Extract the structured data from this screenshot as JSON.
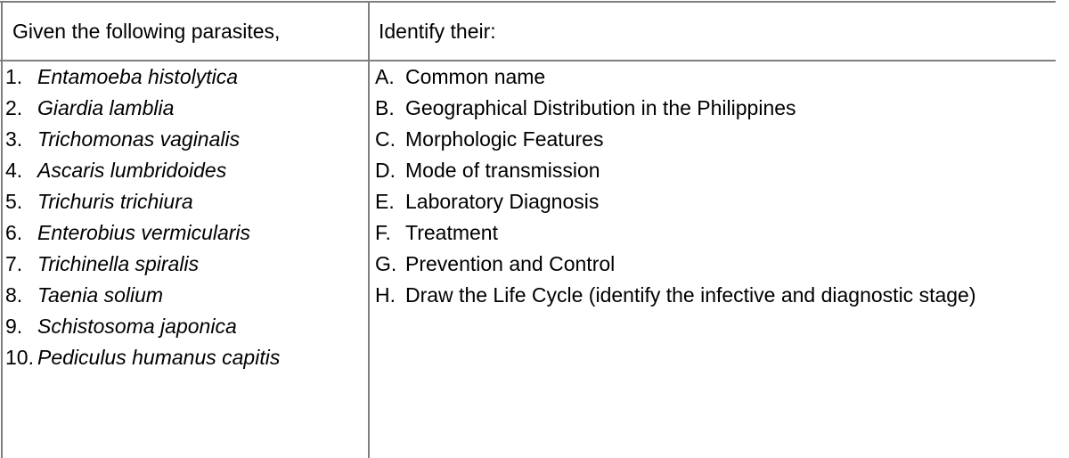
{
  "table": {
    "columns": [
      {
        "header": "Given the following parasites,",
        "list_style": "decimal",
        "items": [
          {
            "marker": "1.",
            "label": "Entamoeba histolytica"
          },
          {
            "marker": "2.",
            "label": "Giardia lamblia"
          },
          {
            "marker": "3.",
            "label": "Trichomonas vaginalis"
          },
          {
            "marker": "4.",
            "label": "Ascaris lumbridoides"
          },
          {
            "marker": "5.",
            "label": "Trichuris trichiura"
          },
          {
            "marker": "6.",
            "label": "Enterobius vermicularis"
          },
          {
            "marker": "7.",
            "label": "Trichinella spiralis"
          },
          {
            "marker": "8.",
            "label": "Taenia solium"
          },
          {
            "marker": "9.",
            "label": "Schistosoma japonica"
          },
          {
            "marker": "10.",
            "label": "Pediculus humanus capitis"
          }
        ]
      },
      {
        "header": "Identify their:",
        "list_style": "upper-alpha",
        "items": [
          {
            "marker": "A.",
            "label": "Common name"
          },
          {
            "marker": "B.",
            "label": "Geographical Distribution in the Philippines"
          },
          {
            "marker": "C.",
            "label": "Morphologic Features"
          },
          {
            "marker": "D.",
            "label": "Mode of transmission"
          },
          {
            "marker": "E.",
            "label": "Laboratory Diagnosis"
          },
          {
            "marker": "F.",
            "label": "Treatment"
          },
          {
            "marker": "G.",
            "label": "Prevention and Control"
          },
          {
            "marker": "H.",
            "label": "Draw the Life Cycle (identify the infective and diagnostic stage)"
          }
        ]
      }
    ]
  },
  "colors": {
    "text": "#000000",
    "rule": "#7f7f7f",
    "background": "#ffffff"
  }
}
